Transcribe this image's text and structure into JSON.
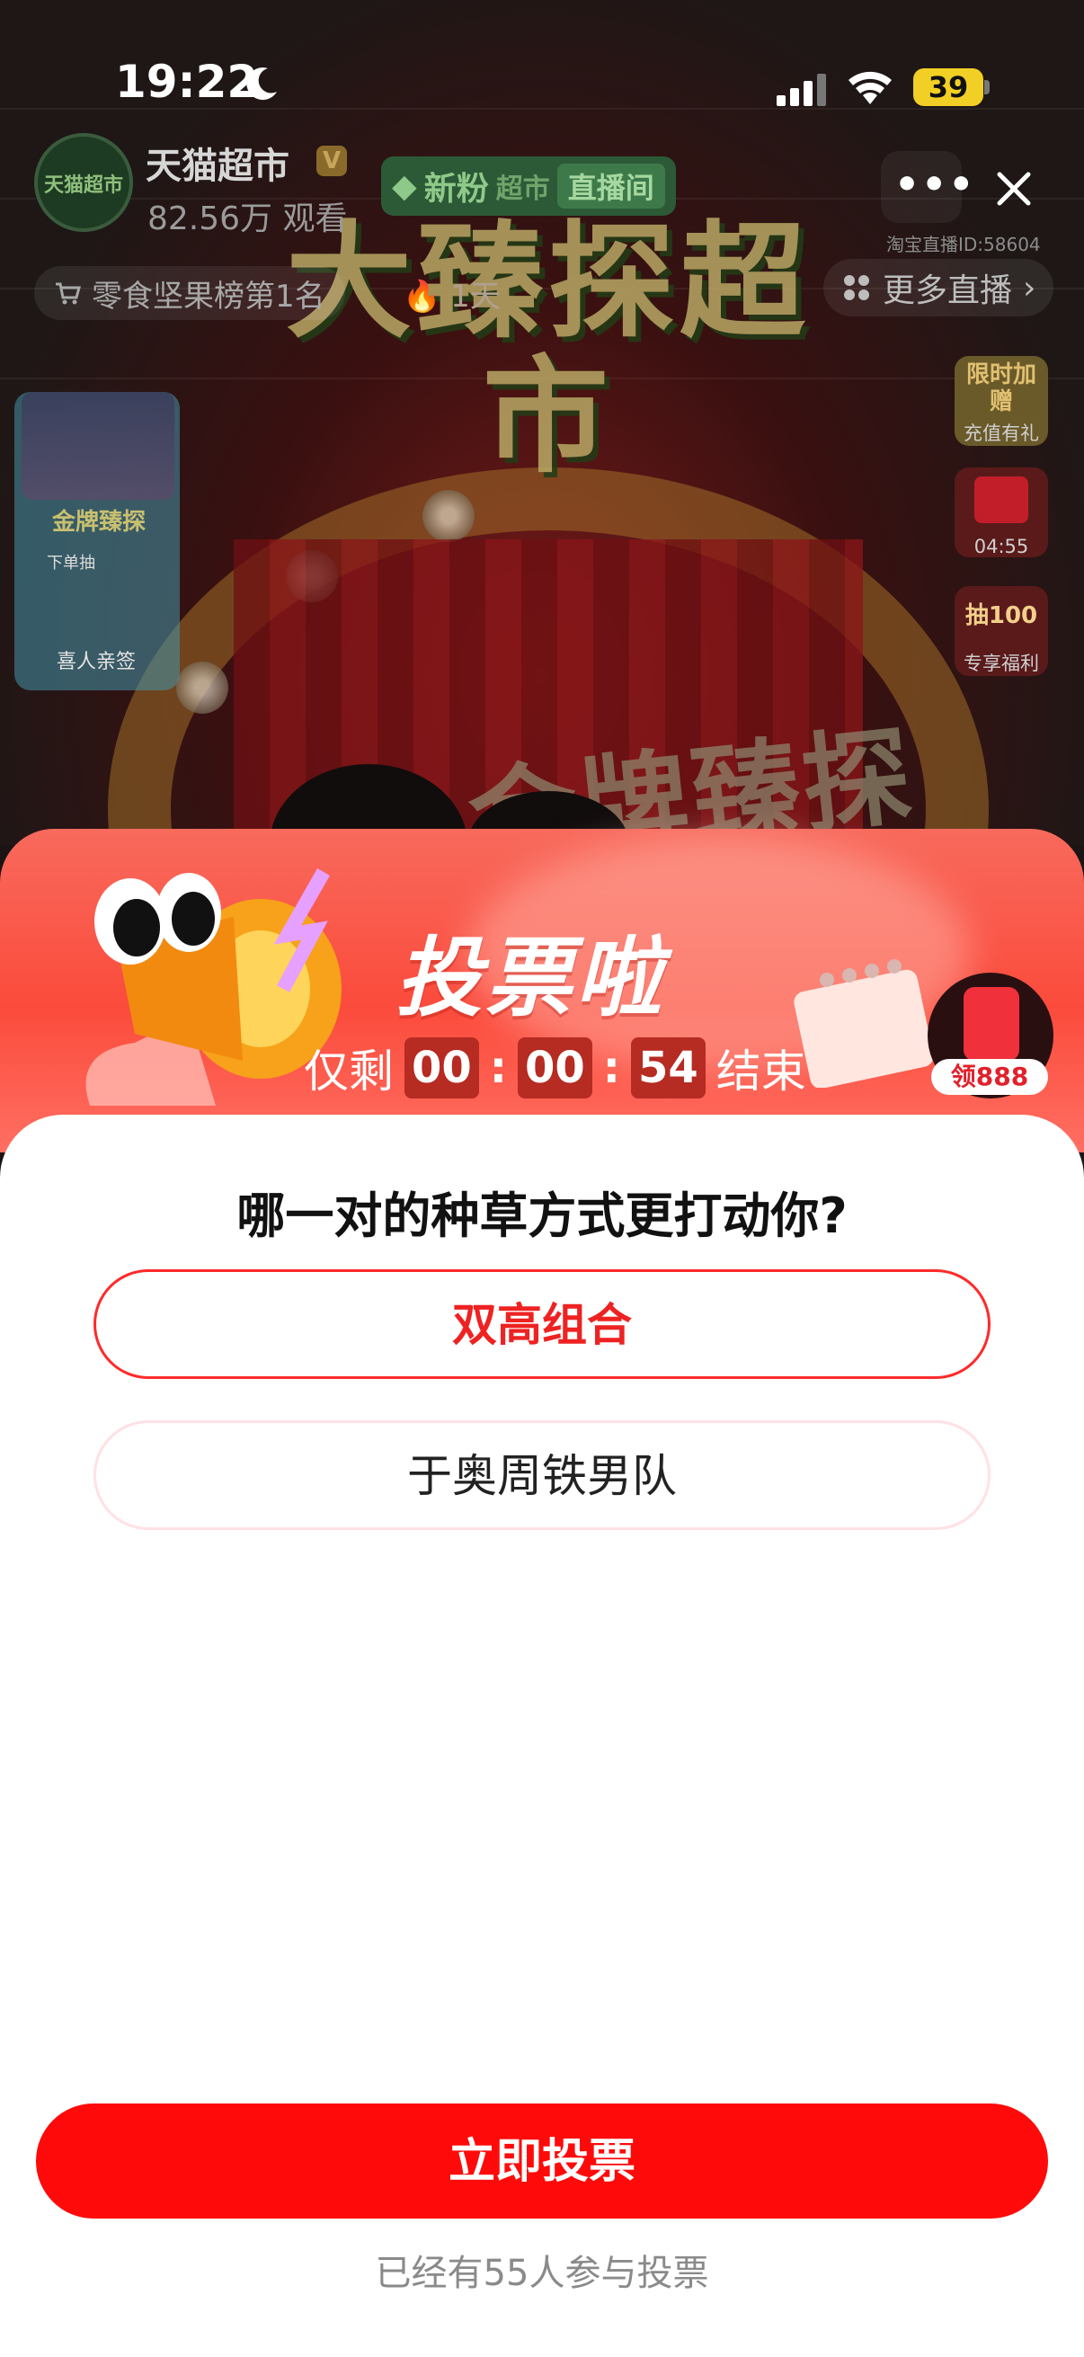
{
  "status_bar": {
    "time": "19:22",
    "battery": "39"
  },
  "live_header": {
    "store_name": "天猫超市",
    "avatar_text": "天猫超市",
    "viewers": "82.56万 观看",
    "fan_tag": "新粉",
    "fan_tag_sub": "直播间",
    "fan_tag_mid": "超市",
    "room_id": "淘宝直播ID:58604",
    "rank_text": "零食坚果榜第1名",
    "rank_days": "1天",
    "more_live": "更多直播"
  },
  "stream": {
    "big_title": "大臻探超市",
    "sub_title": "金牌臻探"
  },
  "side_badges": [
    {
      "top_text": "限时加赠",
      "caption": "充值有礼"
    },
    {
      "top_text": "",
      "caption": "04:55"
    },
    {
      "top_text": "抽100",
      "caption": "专享福利"
    }
  ],
  "promo_card": {
    "title": "金牌臻探",
    "sub": "喜人亲签",
    "tag": "下单抽"
  },
  "vote_panel": {
    "title": "投票啦",
    "countdown_prefix": "仅剩",
    "hours": "00",
    "minutes": "00",
    "seconds": "54",
    "countdown_suffix": "结束",
    "red_packet": "领888",
    "question": "哪一对的种草方式更打动你?",
    "options": [
      {
        "label": "双高组合",
        "selected": true
      },
      {
        "label": "于奥周铁男队",
        "selected": false
      }
    ],
    "vote_button": "立即投票",
    "participants": "已经有55人参与投票"
  },
  "colors": {
    "accent": "#ff0a0a",
    "header_gradient": "#fb4b3c",
    "selected_border": "#ff2a2a"
  }
}
